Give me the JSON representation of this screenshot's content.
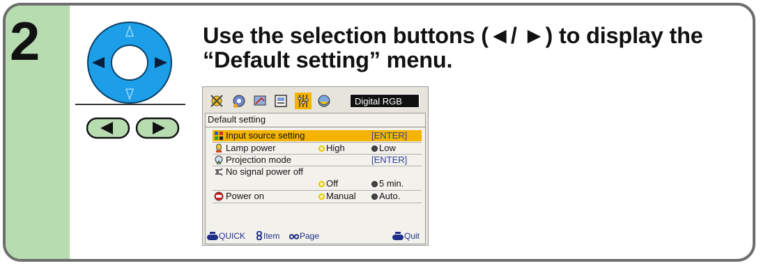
{
  "step": {
    "number": "2"
  },
  "instruction": {
    "line1": "Use the selection buttons (◄/ ►) to display the",
    "line2": "“Default setting” menu."
  },
  "menu": {
    "source_label": "Digital RGB",
    "panel_title": "Default setting",
    "rows": [
      {
        "label": "Input source setting",
        "value": "[ENTER]",
        "icon": "input-source-icon",
        "selected": true
      },
      {
        "label": "Lamp power",
        "opt1": "High",
        "opt2": "Low",
        "icon": "lamp-icon"
      },
      {
        "label": "Projection mode",
        "value": "[ENTER]",
        "icon": "projection-icon"
      },
      {
        "label": "No signal power off",
        "icon": "power-off-icon"
      },
      {
        "opt1": "Off",
        "opt2": "5 min."
      },
      {
        "label": "Power on",
        "opt1": "Manual",
        "opt2": "Auto.",
        "icon": "power-on-icon"
      }
    ],
    "footer": {
      "quick": "QUICK",
      "item": "Item",
      "page": "Page",
      "quit": "Quit"
    }
  },
  "colors": {
    "step_band": "#b7dcb0",
    "pad_blue": "#1c9fe8",
    "highlight": "#f5b400",
    "frame": "#6e6e6e"
  }
}
